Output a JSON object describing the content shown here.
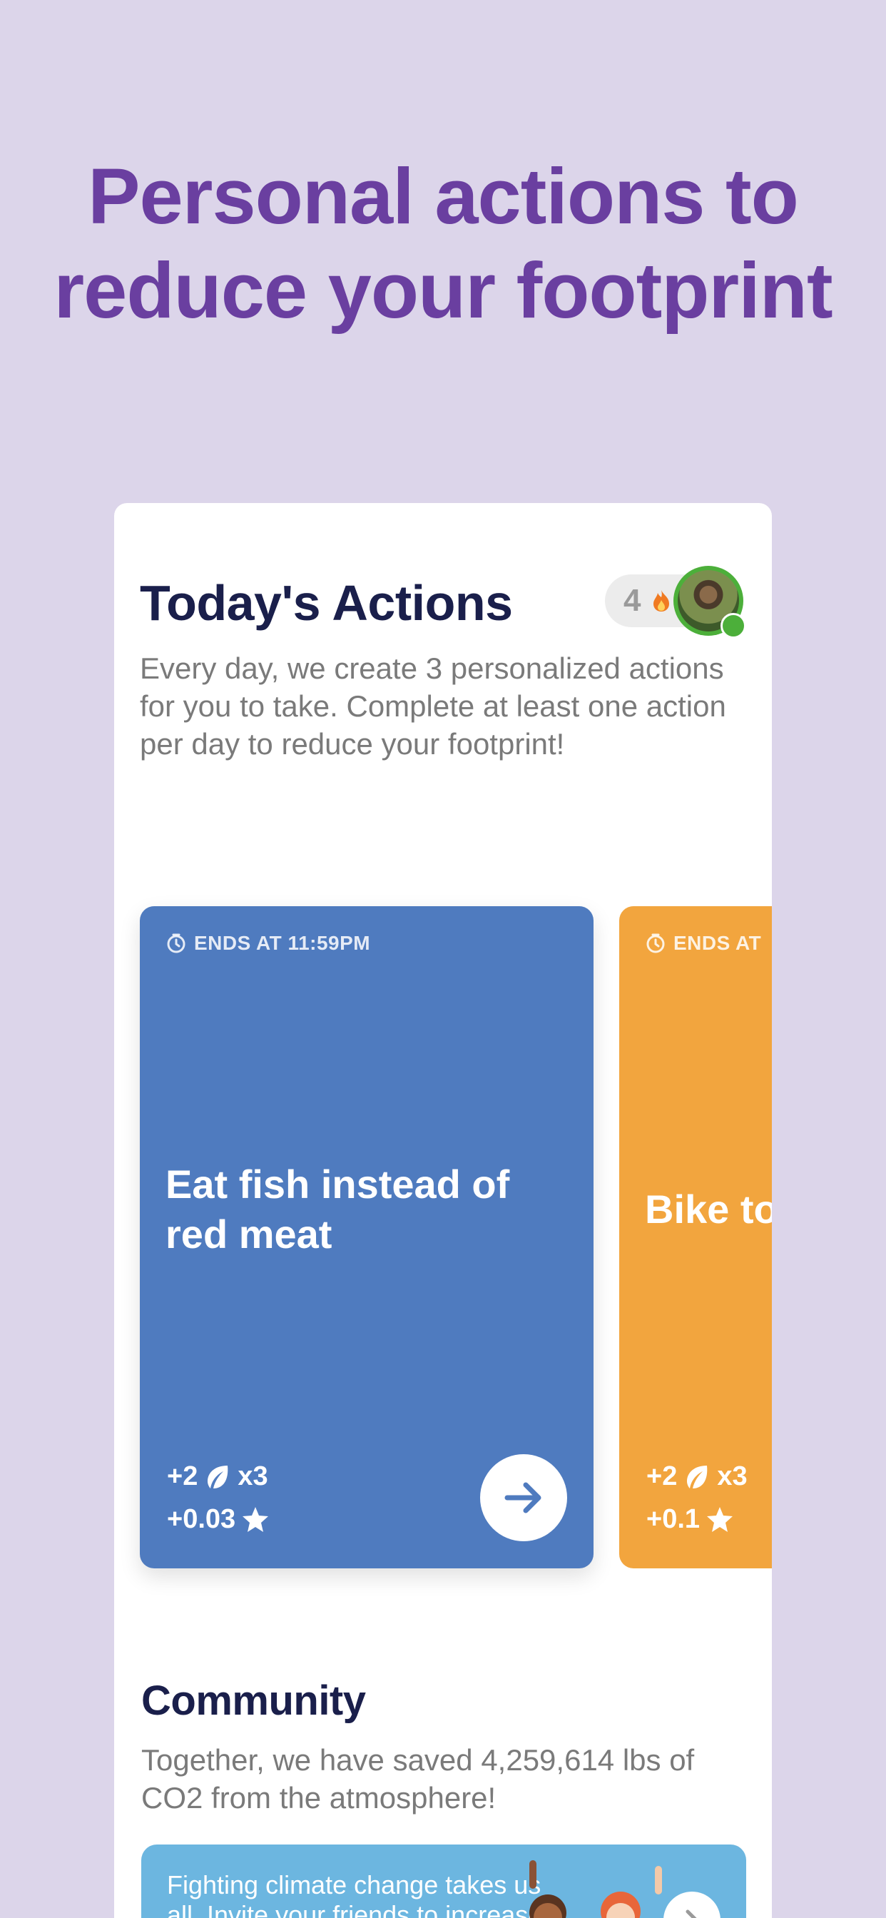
{
  "headline": {
    "line1": "Personal actions to",
    "line2": "reduce your footprint"
  },
  "today": {
    "title": "Today's Actions",
    "description": "Every day, we create 3 personalized actions for you to take. Complete at least one action per day to reduce your footprint!",
    "streak_count": "4"
  },
  "actions": [
    {
      "ends_label": "ENDS AT 11:59PM",
      "title": "Eat fish instead of red meat",
      "leaf_points": "+2",
      "leaf_multiplier": "x3",
      "star_points": "+0.03",
      "color": "#4f7bbf"
    },
    {
      "ends_label": "ENDS AT",
      "title": "Bike to",
      "leaf_points": "+2",
      "leaf_multiplier": "x3",
      "star_points": "+0.1",
      "color": "#f2a53e"
    }
  ],
  "community": {
    "title": "Community",
    "description": "Together, we have saved 4,259,614 lbs of CO2 from the atmosphere!",
    "invite_text": "Fighting climate change takes us all. Invite your friends to increase"
  },
  "colors": {
    "background": "#dcd5ea",
    "headline": "#6a3fa0",
    "title": "#1a1f4b",
    "invite_banner": "#6cb6e0"
  },
  "icons": [
    "flame-icon",
    "clock-icon",
    "leaf-icon",
    "star-icon",
    "arrow-right-icon",
    "chevron-right-icon"
  ]
}
